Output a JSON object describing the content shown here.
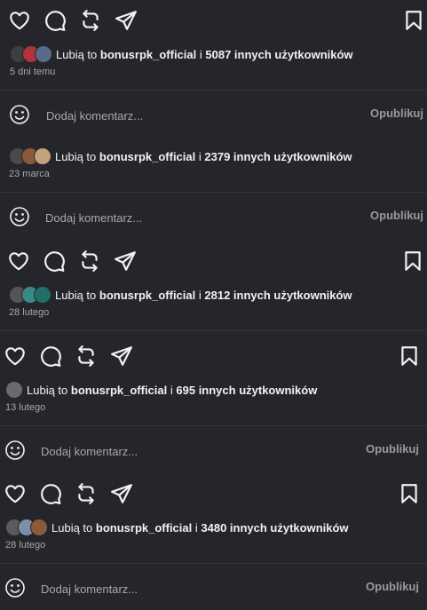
{
  "colors": {
    "background": "#25262b",
    "text": "#f2f2f2",
    "muted": "#a8a8a8",
    "publish": "#9a9a9d",
    "divider": "#34353a"
  },
  "icons": [
    "heart-icon",
    "comment-icon",
    "repost-icon",
    "share-icon",
    "bookmark-icon",
    "emoji-icon"
  ],
  "posts": [
    {
      "likes": {
        "prefix": "Lubią to",
        "user": "bonusrpk_official",
        "connector": "i",
        "others": "5087 innych użytkowników"
      },
      "date": "5 dni temu",
      "avatar_colors": [
        "#3e3e3e",
        "#b4323a",
        "#5b6a8c"
      ],
      "comment": {
        "placeholder": "Dodaj komentarz...",
        "publish": "Opublikuj"
      }
    },
    {
      "likes": {
        "prefix": "Lubią to",
        "user": "bonusrpk_official",
        "connector": "i",
        "others": "2379 innych użytkowników"
      },
      "date": "23 marca",
      "avatar_colors": [
        "#4a4a4a",
        "#8a5a3c",
        "#c4a27a"
      ],
      "comment": {
        "placeholder": "Dodaj komentarz...",
        "publish": "Opublikuj"
      }
    },
    {
      "likes": {
        "prefix": "Lubią to",
        "user": "bonusrpk_official",
        "connector": "i",
        "others": "2812 innych użytkowników"
      },
      "date": "28 lutego",
      "avatar_colors": [
        "#555555",
        "#3a8a84",
        "#1f6f6a"
      ]
    },
    {
      "likes": {
        "prefix": "Lubią to",
        "user": "bonusrpk_official",
        "connector": "i",
        "others": "695 innych użytkowników"
      },
      "date": "13 lutego",
      "avatar_colors": [
        "#6a6a6a"
      ],
      "comment": {
        "placeholder": "Dodaj komentarz...",
        "publish": "Opublikuj"
      }
    },
    {
      "likes": {
        "prefix": "Lubią to",
        "user": "bonusrpk_official",
        "connector": "i",
        "others": "3480 innych użytkowników"
      },
      "date": "28 lutego",
      "avatar_colors": [
        "#5a5a5a",
        "#7d8fa6",
        "#8a5a3c"
      ],
      "comment": {
        "placeholder": "Dodaj komentarz...",
        "publish": "Opublikuj"
      }
    }
  ]
}
